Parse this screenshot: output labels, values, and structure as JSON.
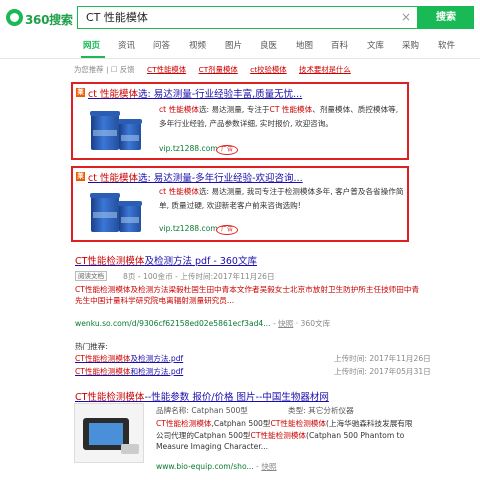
{
  "header": {
    "logo_text": "360搜索",
    "query": "CT 性能模体",
    "search_button": "搜索"
  },
  "tabs": [
    {
      "label": "网页",
      "active": true
    },
    {
      "label": "资讯"
    },
    {
      "label": "问答"
    },
    {
      "label": "视频"
    },
    {
      "label": "图片"
    },
    {
      "label": "良医"
    },
    {
      "label": "地图"
    },
    {
      "label": "百科"
    },
    {
      "label": "文库"
    },
    {
      "label": "采购"
    },
    {
      "label": "软件"
    }
  ],
  "suggest": {
    "prefix": "为您推荐",
    "feedback": "反馈",
    "links": [
      "CT性能模体",
      "CT剂量模体",
      "ct校验模体",
      "技术要材是什么"
    ]
  },
  "ad1": {
    "title_a": "ct 性能模体",
    "title_b": "选",
    "title_c": ": 易达测量-行业经验丰富,质量无忧...",
    "desc_a": "ct 性能模体",
    "desc_b": "选: 易达测量, 专注于",
    "desc_c": "CT 性能模体",
    "desc_d": "、剂量模体、质控模体等, 多年行业经验, 产品参数详细, 实时报价, 欢迎咨询。",
    "url": "vip.tz1288.com",
    "badge": "广告"
  },
  "ad2": {
    "title_a": "ct 性能模体",
    "title_b": "选",
    "title_c": ": 易达测量-多年行业经验-欢迎咨询...",
    "desc_a": "ct 性能模体",
    "desc_b": "选: 易达测量, 我司专注于检测模体多年, 客户普及各省操作简单, 质量过硬, 欢迎新老客户前来咨询选购!",
    "url": "vip.tz1288.com",
    "badge": "广告"
  },
  "doc": {
    "title_a": "CT性能检测模体",
    "title_b": "及检测方法 pdf - 360文库",
    "tag": "阅读文档",
    "meta": "8页 - 100金币 - 上传时间:2017年11月26日",
    "desc": "CT性能检测模体及检测方法梁毅杜国生田中青本文作者吴毅女士北京市放射卫生防护所主任技师田中青先生中国计量科学研究院电离辐射测量研究员...",
    "url": "wenku.so.com/d/9306cf62158ed02e5861ecf3ad4...",
    "snapshot": "快照",
    "library": "360文库"
  },
  "related": {
    "heading": "热门推荐:",
    "items": [
      {
        "link_a": "CT性能检测模体",
        "link_b": "及检测方法.pdf",
        "date": "上传时间: 2017年11月26日"
      },
      {
        "link_a": "CT性能检测模体",
        "link_b": "和检测方法.pdf",
        "date": "上传时间: 2017年05月31日"
      }
    ]
  },
  "result3": {
    "title_a": "CT性能检测模体",
    "title_b": "--性能参数 报价/价格 图片--中国生物器材网",
    "brand": "品牌名称:    Catphan 500型",
    "type": "类型:    其它分析仪器",
    "desc_a": "CT性能检测模体",
    "desc_b": ",Catphan 500型",
    "desc_c": "CT性能检测模体",
    "desc_d": "(上海华驰森科技发展有限公司代理的Catphan 500型",
    "desc_e": "CT性能检测模体",
    "desc_f": "(Catphan 500 Phantom to Measure Imaging Character...",
    "url": "www.bio-equip.com/sho...",
    "snapshot": "快照"
  },
  "colors": {
    "brand_green": "#19b955",
    "highlight_red": "#c00",
    "link_blue": "#1a0dab",
    "url_green": "#0a7a30",
    "ad_border": "#e02020"
  }
}
